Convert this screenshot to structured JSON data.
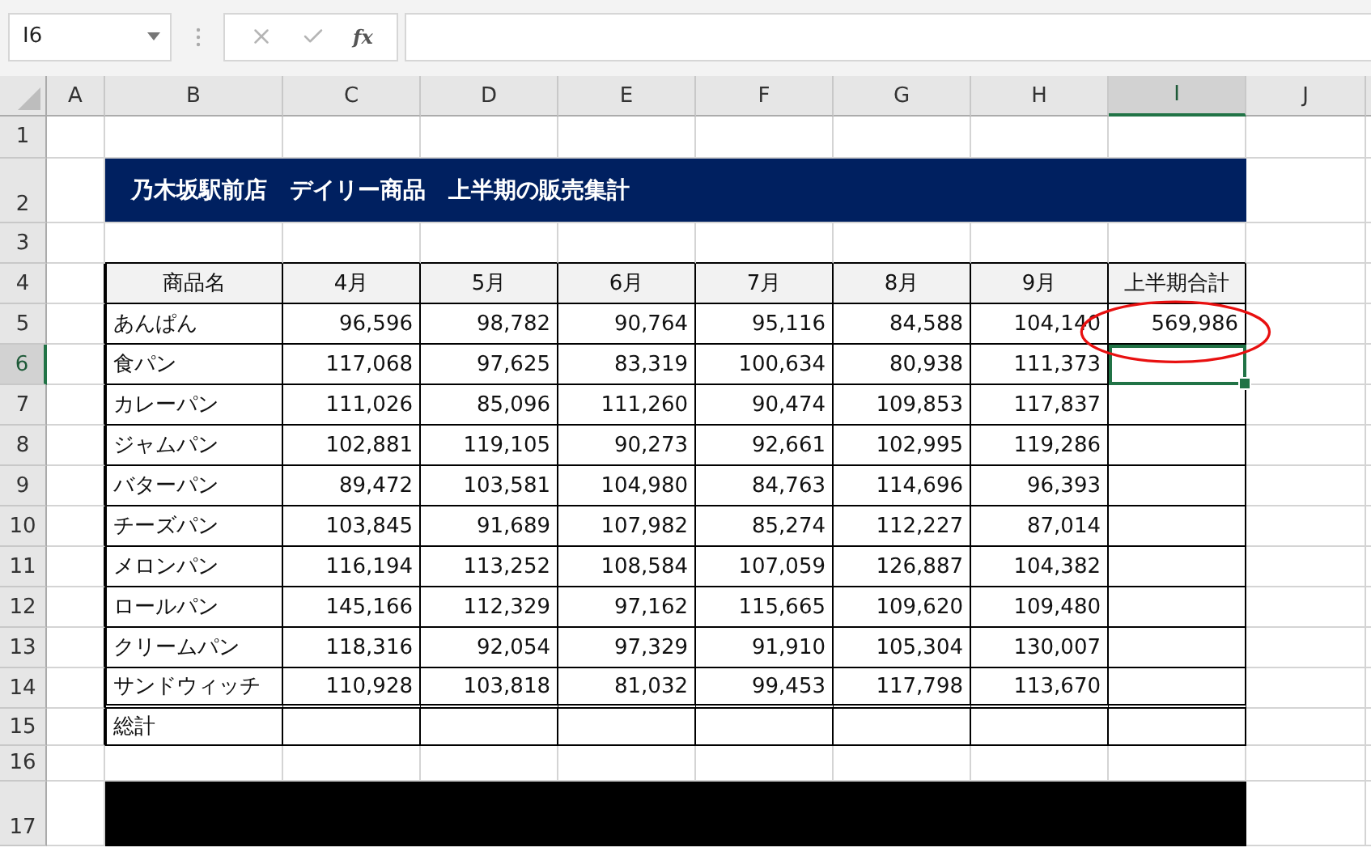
{
  "name_box": {
    "value": "I6"
  },
  "formula_bar": {
    "function_label": "fx"
  },
  "columns": [
    {
      "label": "A",
      "selected": false
    },
    {
      "label": "B",
      "selected": false
    },
    {
      "label": "C",
      "selected": false
    },
    {
      "label": "D",
      "selected": false
    },
    {
      "label": "E",
      "selected": false
    },
    {
      "label": "F",
      "selected": false
    },
    {
      "label": "G",
      "selected": false
    },
    {
      "label": "H",
      "selected": false
    },
    {
      "label": "I",
      "selected": true
    },
    {
      "label": "J",
      "selected": false
    }
  ],
  "rows": [
    {
      "label": "1",
      "selected": false
    },
    {
      "label": "2",
      "selected": false
    },
    {
      "label": "3",
      "selected": false
    },
    {
      "label": "4",
      "selected": false
    },
    {
      "label": "5",
      "selected": false
    },
    {
      "label": "6",
      "selected": true
    },
    {
      "label": "7",
      "selected": false
    },
    {
      "label": "8",
      "selected": false
    },
    {
      "label": "9",
      "selected": false
    },
    {
      "label": "10",
      "selected": false
    },
    {
      "label": "11",
      "selected": false
    },
    {
      "label": "12",
      "selected": false
    },
    {
      "label": "13",
      "selected": false
    },
    {
      "label": "14",
      "selected": false
    },
    {
      "label": "15",
      "selected": false
    },
    {
      "label": "16",
      "selected": false
    },
    {
      "label": "17",
      "selected": false
    }
  ],
  "title": "乃木坂駅前店　デイリー商品　上半期の販売集計",
  "table": {
    "columns": [
      "商品名",
      "4月",
      "5月",
      "6月",
      "7月",
      "8月",
      "9月",
      "上半期合計"
    ],
    "rows": [
      {
        "name": "あんぱん",
        "values": [
          "96,596",
          "98,782",
          "90,764",
          "95,116",
          "84,588",
          "104,140"
        ],
        "total": "569,986"
      },
      {
        "name": "食パン",
        "values": [
          "117,068",
          "97,625",
          "83,319",
          "100,634",
          "80,938",
          "111,373"
        ]
      },
      {
        "name": "カレーパン",
        "values": [
          "111,026",
          "85,096",
          "111,260",
          "90,474",
          "109,853",
          "117,837"
        ]
      },
      {
        "name": "ジャムパン",
        "values": [
          "102,881",
          "119,105",
          "90,273",
          "92,661",
          "102,995",
          "119,286"
        ]
      },
      {
        "name": "バターパン",
        "values": [
          "89,472",
          "103,581",
          "104,980",
          "84,763",
          "114,696",
          "96,393"
        ]
      },
      {
        "name": "チーズパン",
        "values": [
          "103,845",
          "91,689",
          "107,982",
          "85,274",
          "112,227",
          "87,014"
        ]
      },
      {
        "name": "メロンパン",
        "values": [
          "116,194",
          "113,252",
          "108,584",
          "107,059",
          "126,887",
          "104,382"
        ]
      },
      {
        "name": "ロールパン",
        "values": [
          "145,166",
          "112,329",
          "97,162",
          "115,665",
          "109,620",
          "109,480"
        ]
      },
      {
        "name": "クリームパン",
        "values": [
          "118,316",
          "92,054",
          "97,329",
          "91,910",
          "105,304",
          "130,007"
        ]
      },
      {
        "name": "サンドウィッチ",
        "values": [
          "110,928",
          "103,818",
          "81,032",
          "99,453",
          "117,798",
          "113,670"
        ]
      }
    ],
    "total_row": {
      "label": "総計"
    }
  }
}
